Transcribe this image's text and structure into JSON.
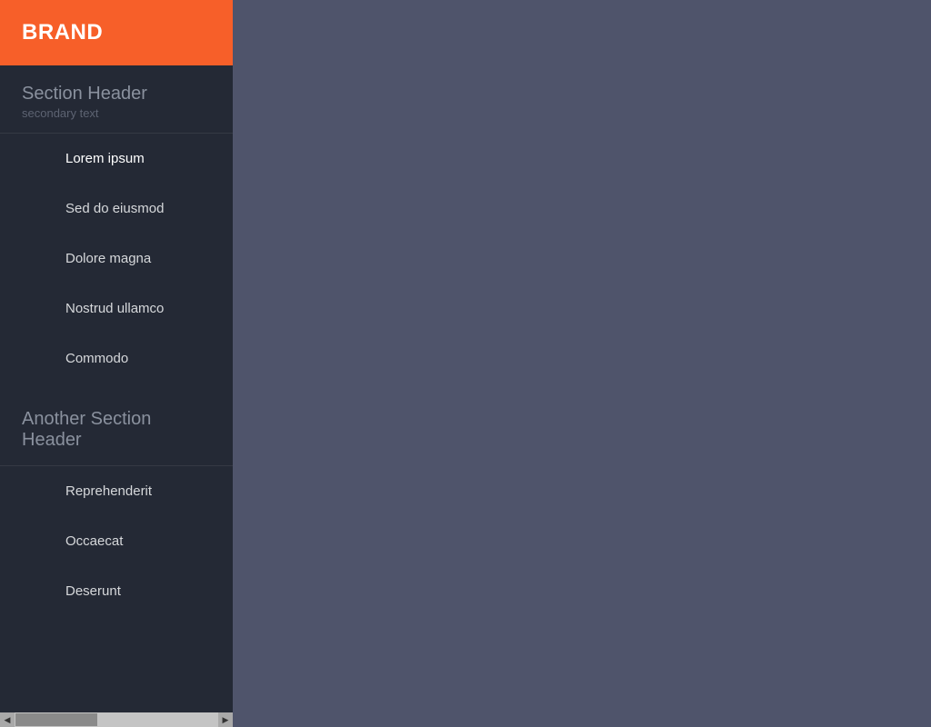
{
  "brand": {
    "label": "BRAND"
  },
  "sidebar": {
    "sections": [
      {
        "title": "Section Header",
        "secondary": "secondary text",
        "items": [
          {
            "label": "Lorem ipsum",
            "active": true
          },
          {
            "label": "Sed do eiusmod",
            "active": false
          },
          {
            "label": "Dolore magna",
            "active": false
          },
          {
            "label": "Nostrud ullamco",
            "active": false
          },
          {
            "label": "Commodo",
            "active": false
          }
        ]
      },
      {
        "title": "Another Section Header",
        "secondary": null,
        "items": [
          {
            "label": "Reprehenderit",
            "active": false
          },
          {
            "label": "Occaecat",
            "active": false
          },
          {
            "label": "Deserunt",
            "active": false
          }
        ]
      }
    ]
  }
}
